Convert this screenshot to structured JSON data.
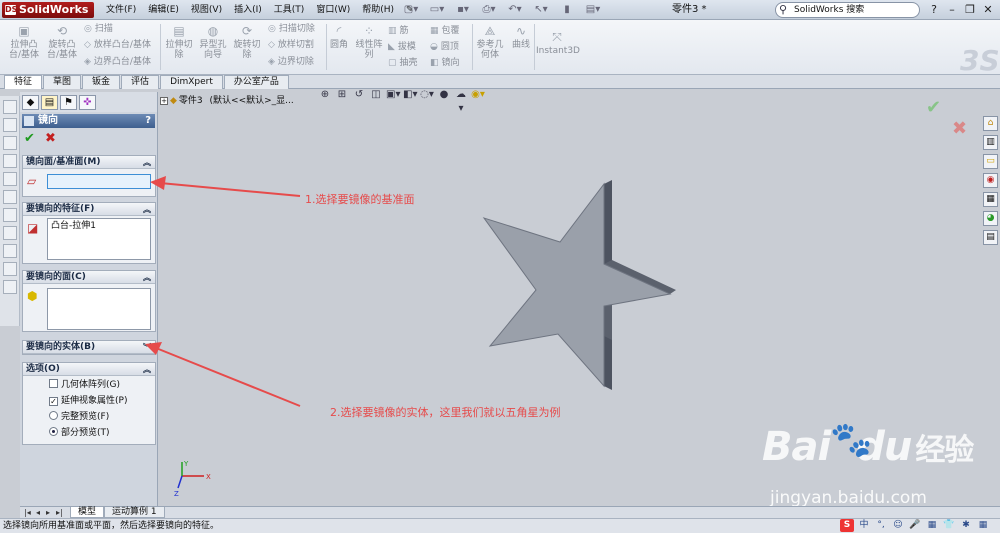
{
  "app": {
    "logo": "SolidWorks",
    "doc_title": "零件3 *"
  },
  "menu": [
    "文件(F)",
    "编辑(E)",
    "视图(V)",
    "插入(I)",
    "工具(T)",
    "窗口(W)",
    "帮助(H)"
  ],
  "search": {
    "placeholder": "SolidWorks 搜索"
  },
  "toolbar": {
    "extrude_boss": "拉伸凸\n台/基体",
    "revolve_boss": "旋转凸\n台/基体",
    "sweep": "扫描",
    "loft_boss": "放样凸台/基体",
    "boundary_boss": "边界凸台/基体",
    "extrude_cut": "拉伸切\n除",
    "hole_wizard": "异型孔\n向导",
    "revolve_cut": "旋转切\n除",
    "sweep_cut": "扫描切除",
    "loft_cut": "放样切割",
    "boundary_cut": "边界切除",
    "fillet": "圆角",
    "linear_pattern": "线性阵\n列",
    "rib": "筋",
    "draft": "拔模",
    "shell": "抽壳",
    "wrap": "包覆",
    "dome": "圆顶",
    "mirror": "镜向",
    "ref_geometry": "参考几\n何体",
    "curves": "曲线",
    "instant3d": "Instant3D"
  },
  "tabs": [
    "特征",
    "草图",
    "钣金",
    "评估",
    "DimXpert",
    "办公室产品"
  ],
  "feature_tree": {
    "root": "零件3",
    "config": "(默认<<默认>_显..."
  },
  "pm": {
    "title": "镜向",
    "help": "?",
    "group_plane": {
      "title": "镜向面/基准面(M)",
      "value": ""
    },
    "group_features": {
      "title": "要镜向的特征(F)",
      "items": [
        "凸台-拉伸1"
      ]
    },
    "group_faces": {
      "title": "要镜向的面(C)"
    },
    "group_bodies": {
      "title": "要镜向的实体(B)"
    },
    "group_options": {
      "title": "选项(O)",
      "geometry_pattern": "几何体阵列(G)",
      "propagate_visual": "延伸视象属性(P)",
      "full_preview": "完整预览(F)",
      "partial_preview": "部分预览(T)"
    }
  },
  "annotations": {
    "step1": "1.选择要镜像的基准面",
    "step2": "2.选择要镜像的实体，这里我们就以五角星为例"
  },
  "watermark": {
    "brand": "Bai",
    "brand2": "du",
    "cn": "经验",
    "url": "jingyan.baidu.com"
  },
  "bottom_tabs": [
    "模型",
    "运动算例 1"
  ],
  "status": {
    "text": "选择镜向所用基准面或平面，然后选择要镜向的特征。"
  },
  "ime": [
    "S",
    "中",
    "°,",
    "☺",
    "🎤",
    "▦",
    "👕",
    "✱",
    "▦"
  ],
  "triad": {
    "x": "X",
    "y": "Y",
    "z": "Z"
  },
  "colors": {
    "annotation": "#e64b4b",
    "ok": "#1f9a1f",
    "cancel": "#c32020",
    "star_face": "#9aa0aa",
    "star_side": "#4d5360"
  }
}
